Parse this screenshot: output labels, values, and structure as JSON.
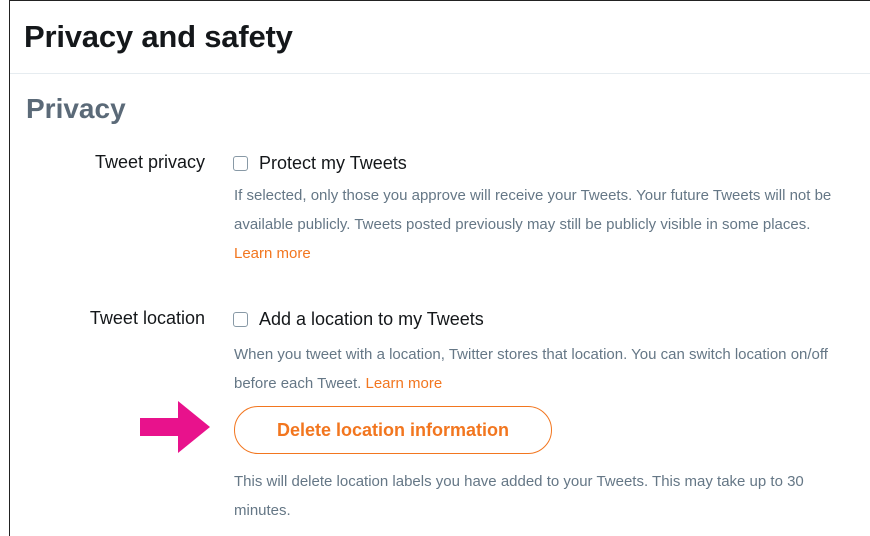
{
  "header": {
    "title": "Privacy and safety"
  },
  "privacy": {
    "section_title": "Privacy",
    "tweet_privacy": {
      "label": "Tweet privacy",
      "checkbox_label": "Protect my Tweets",
      "checked": false,
      "help_text": "If selected, only those you approve will receive your Tweets. Your future Tweets will not be available publicly. Tweets posted previously may still be publicly visible in some places.",
      "learn_more": "Learn more"
    },
    "tweet_location": {
      "label": "Tweet location",
      "checkbox_label": "Add a location to my Tweets",
      "checked": false,
      "help_text": "When you tweet with a location, Twitter stores that location. You can switch location on/off before each Tweet.",
      "learn_more": "Learn more",
      "delete_button": "Delete location information",
      "delete_help": "This will delete location labels you have added to your Tweets. This may take up to 30 minutes."
    }
  },
  "colors": {
    "accent": "#f2761f",
    "arrow": "#e8128c",
    "section_title": "#5b6a78"
  },
  "icons": {
    "annotation_arrow": "right-arrow-icon"
  }
}
